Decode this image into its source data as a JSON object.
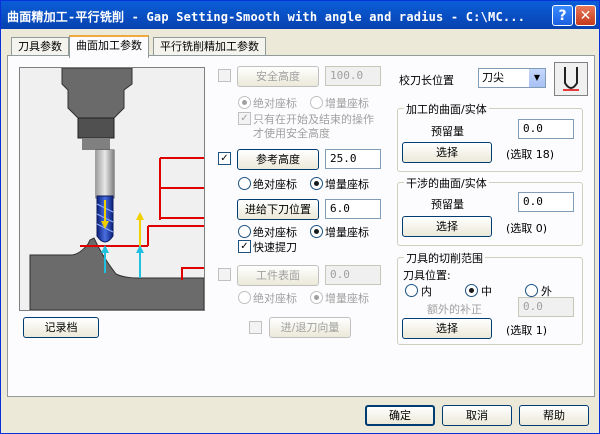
{
  "window": {
    "title": "曲面精加工-平行铣削 - Gap Setting-Smooth with angle and radius - C:\\MC...",
    "help_label": "?",
    "close_label": "✕"
  },
  "tabs": [
    {
      "label": "刀具参数"
    },
    {
      "label": "曲面加工参数"
    },
    {
      "label": "平行铣削精加工参数"
    }
  ],
  "clearance": {
    "label": "安全高度",
    "value": "100.0",
    "checked": false,
    "abs_label": "绝对座标",
    "inc_label": "增量座标",
    "note_line1": "只有在开始及结束的操作",
    "note_line2": "才使用安全高度"
  },
  "retract": {
    "label": "参考高度",
    "value": "25.0",
    "checked": true,
    "abs_label": "绝对座标",
    "inc_label": "增量座标"
  },
  "feed_plane": {
    "label": "进给下刀位置",
    "value": "6.0",
    "abs_label": "绝对座标",
    "inc_label": "增量座标",
    "fast_retract_label": "快速提刀"
  },
  "top_stock": {
    "label": "工件表面",
    "value": "0.0",
    "abs_label": "绝对座标",
    "inc_label": "增量座标"
  },
  "approach_label": "进/退刀向量",
  "record_label": "记录档",
  "tip_comp": {
    "label": "校刀长位置",
    "value": "刀尖"
  },
  "drive_surfaces": {
    "title": "加工的曲面/实体",
    "stock_label": "预留量",
    "stock_value": "0.0",
    "select_label": "选择",
    "count_text": "(选取 18)"
  },
  "check_surfaces": {
    "title": "干涉的曲面/实体",
    "stock_label": "预留量",
    "stock_value": "0.0",
    "select_label": "选择",
    "count_text": "(选取 0)"
  },
  "containment": {
    "title": "刀具的切削范围",
    "position_label": "刀具位置:",
    "inside_label": "内",
    "center_label": "中",
    "outside_label": "外",
    "extra_label": "额外的补正",
    "extra_value": "0.0",
    "select_label": "选择",
    "count_text": "(选取 1)"
  },
  "footer": {
    "ok_label": "确定",
    "cancel_label": "取消",
    "help_label": "帮助"
  },
  "colors": {
    "title_bar": "#0842b0",
    "level_line": "#e00000",
    "tool_blue": "#1f3fa8",
    "arrow_yellow": "#f0d000",
    "arrow_cyan": "#20c0e0"
  }
}
